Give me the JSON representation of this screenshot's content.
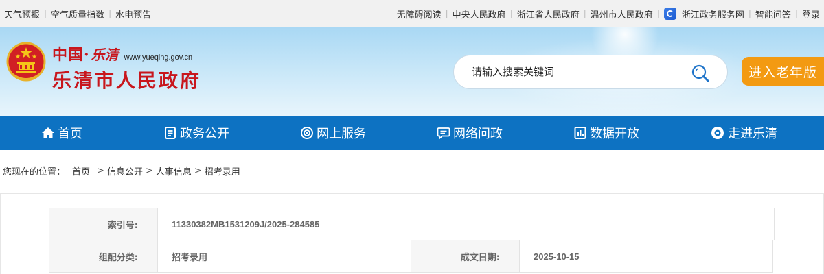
{
  "topbar": {
    "left_links": [
      "天气预报",
      "空气质量指数",
      "水电预告"
    ],
    "right_links": [
      "无障碍阅读",
      "中央人民政府",
      "浙江省人民政府",
      "温州市人民政府"
    ],
    "zwfw_link": "浙江政务服务网",
    "extra_links": [
      "智能问答",
      "登录"
    ]
  },
  "header": {
    "logo_zhongguo": "中国·",
    "logo_city": "乐清",
    "logo_domain": "www.yueqing.gov.cn",
    "logo_title": "乐清市人民政府",
    "search_placeholder": "请输入搜索关键词",
    "elder_button": "进入老年版"
  },
  "nav": {
    "items": [
      {
        "label": "首页",
        "icon": "home-icon"
      },
      {
        "label": "政务公开",
        "icon": "document-icon"
      },
      {
        "label": "网上服务",
        "icon": "service-icon"
      },
      {
        "label": "网络问政",
        "icon": "chat-icon"
      },
      {
        "label": "数据开放",
        "icon": "data-icon"
      },
      {
        "label": "走进乐清",
        "icon": "eye-icon"
      }
    ]
  },
  "breadcrumb": {
    "prefix": "您现在的位置：",
    "items": [
      "首页",
      "信息公开",
      "人事信息",
      "招考录用"
    ],
    "separator": ">"
  },
  "meta": {
    "index_label": "索引号:",
    "index_value": "11330382MB1531209J/2025-284585",
    "category_label": "组配分类:",
    "category_value": "招考录用",
    "date_label": "成文日期:",
    "date_value": "2025-10-15"
  },
  "colors": {
    "nav_bg": "#0d72c2",
    "logo_red": "#c8161d",
    "elder_orange": "#f39a12",
    "topbar_bg": "#f1f1f1"
  }
}
